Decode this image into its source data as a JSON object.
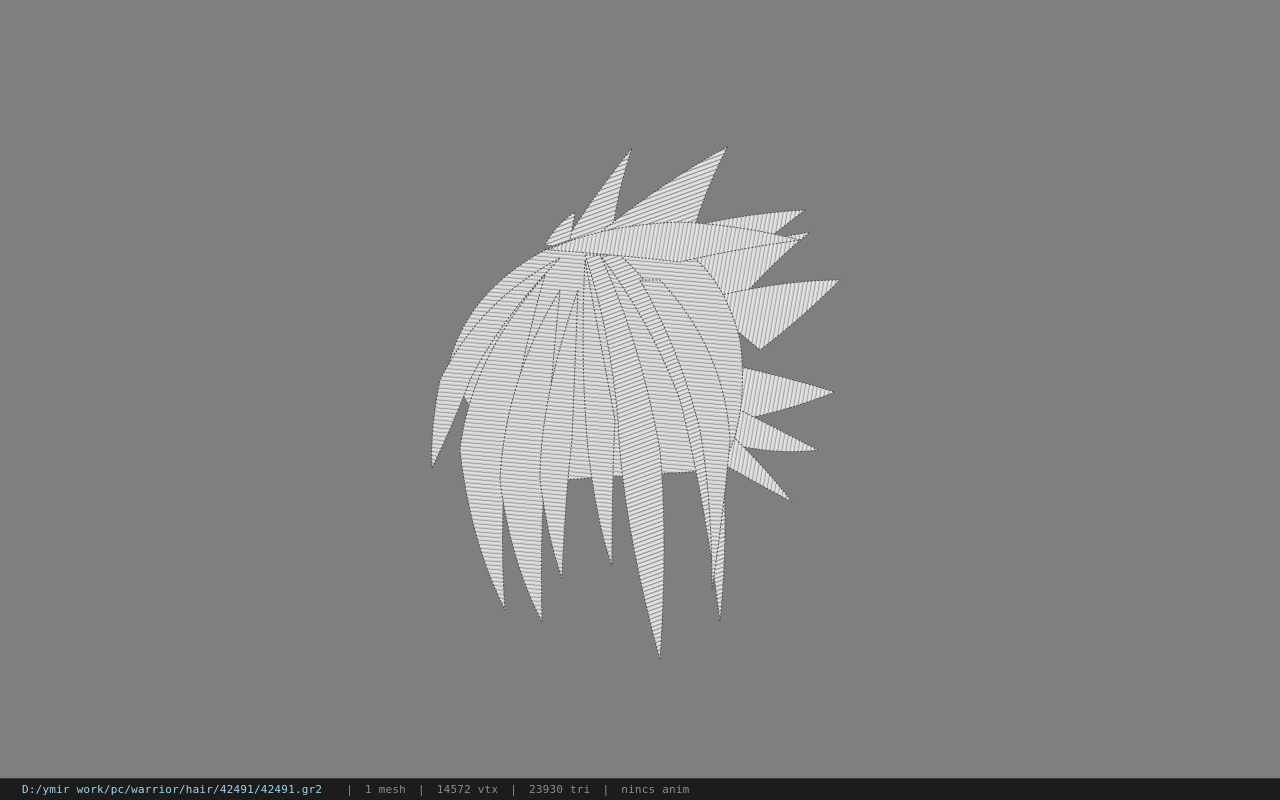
{
  "viewer": {
    "background_color": "#7f7f7f",
    "model_icon": "spiky-hair-mesh-icon"
  },
  "status_bar": {
    "file_path": "D:/ymir work/pc/warrior/hair/42491/42491.gr2",
    "separator": "|",
    "mesh_count": "1 mesh",
    "vertex_count": "14572 vtx",
    "triangle_count": "23930 tri",
    "anim_status": "nincs anim",
    "path_color": "#9bd0e6"
  }
}
